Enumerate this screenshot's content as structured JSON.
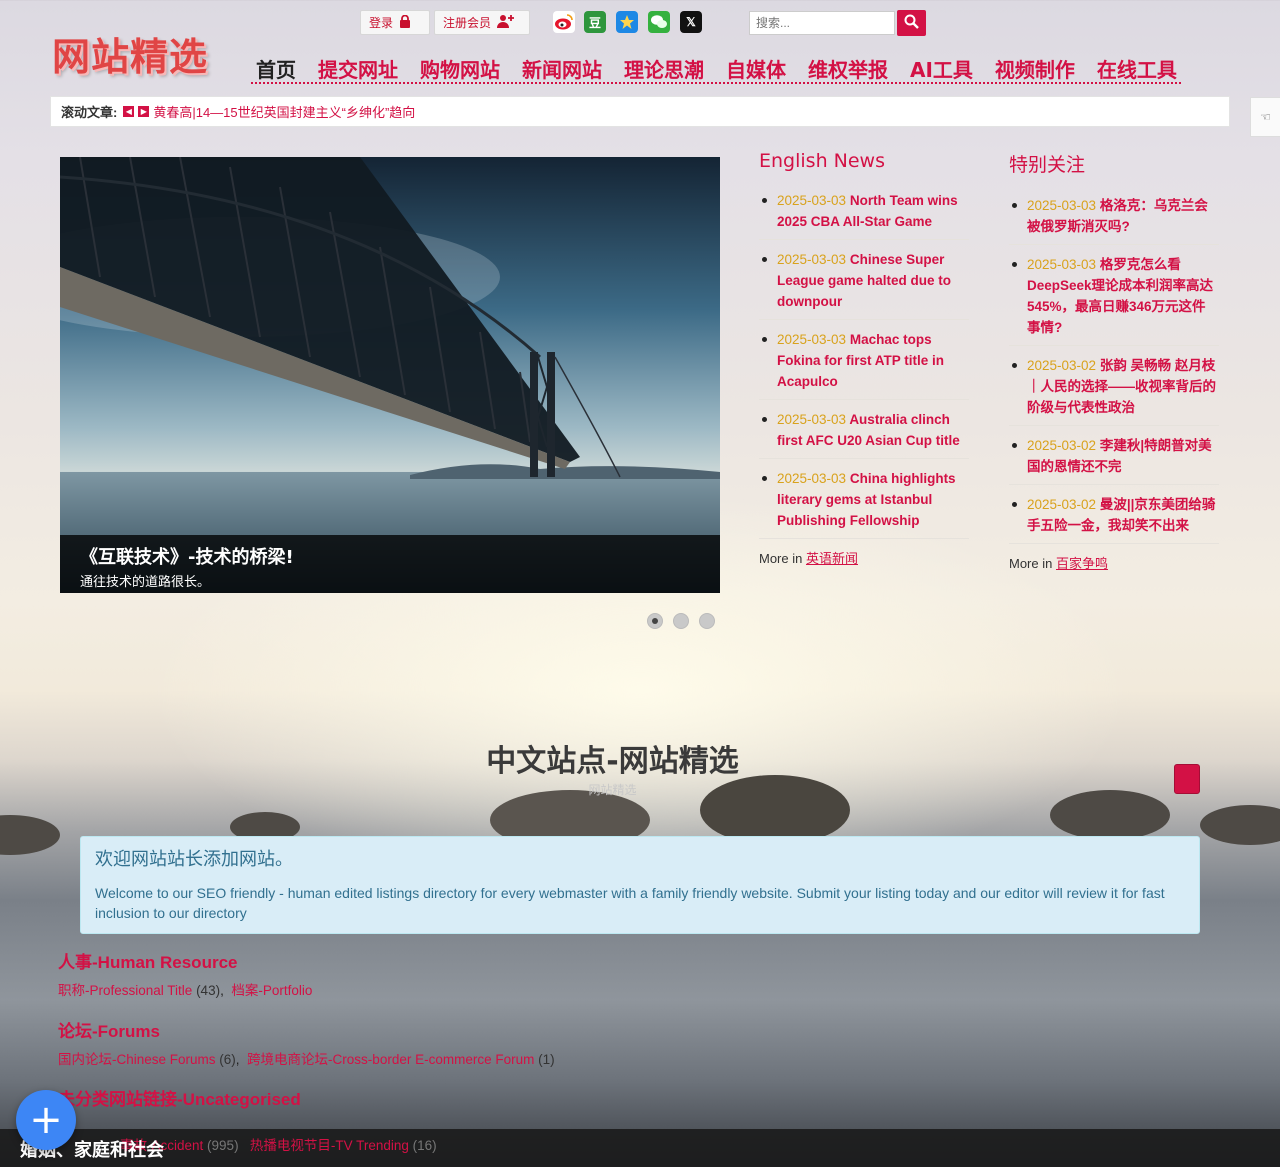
{
  "header": {
    "logo_text": "网站精选",
    "login_label": "登录",
    "register_label": "注册会员",
    "social_icons": [
      "weibo-icon",
      "douban-icon",
      "qzone-icon",
      "wechat-icon",
      "x-icon"
    ],
    "douban_glyph": "豆",
    "x_glyph": "𝕏",
    "search_placeholder": "搜索..."
  },
  "nav": {
    "items": [
      "首页",
      "提交网址",
      "购物网站",
      "新闻网站",
      "理论思潮",
      "自媒体",
      "维权举报",
      "AI工具",
      "视频制作",
      "在线工具"
    ]
  },
  "ticker": {
    "label": "滚动文章:",
    "text": "黄春高|14—15世纪英国封建主义“乡绅化”趋向"
  },
  "slider": {
    "title": "《互联技术》-技术的桥梁!",
    "subtitle": "通往技术的道路很长。",
    "slide_count": 3,
    "active_slide": 1
  },
  "english_news": {
    "heading": "English News",
    "items": [
      {
        "date": "2025-03-03",
        "title": "North Team wins 2025 CBA All-Star Game"
      },
      {
        "date": "2025-03-03",
        "title": "Chinese Super League game halted due to downpour"
      },
      {
        "date": "2025-03-03",
        "title": "Machac tops Fokina for first ATP title in Acapulco"
      },
      {
        "date": "2025-03-03",
        "title": "Australia clinch first AFC U20 Asian Cup title"
      },
      {
        "date": "2025-03-03",
        "title": "China highlights literary gems at Istanbul Publishing Fellowship"
      }
    ],
    "more_prefix": "More in",
    "more_link": "英语新闻"
  },
  "special": {
    "heading": "特别关注",
    "items": [
      {
        "date": "2025-03-03",
        "title": "格洛克：乌克兰会被俄罗斯消灭吗?"
      },
      {
        "date": "2025-03-03",
        "title": "格罗克怎么看DeepSeek理论成本利润率高达545%，最高日赚346万元这件事情?"
      },
      {
        "date": "2025-03-02",
        "title": "张韵 吴畅畅 赵月枝｜人民的选择——收视率背后的阶级与代表性政治"
      },
      {
        "date": "2025-03-02",
        "title": "李建秋|特朗普对美国的恩情还不完"
      },
      {
        "date": "2025-03-02",
        "title": "曼波||京东美团给骑手五险一金，我却笑不出来"
      }
    ],
    "more_prefix": "More in",
    "more_link": "百家争鸣"
  },
  "section": {
    "title": "中文站点-网站精选",
    "subtitle": "网站精选"
  },
  "welcome": {
    "heading": "欢迎网站站长添加网站。",
    "text": "Welcome to our SEO friendly - human edited listings directory for every webmaster with a family friendly website. Submit your listing today and our editor will review it for fast inclusion to our directory"
  },
  "categories": [
    {
      "title": "人事-Human Resource",
      "links": [
        {
          "name": "职称-Professional Title",
          "count": "(43)"
        },
        {
          "name": "档案-Portfolio",
          "count": ""
        }
      ]
    },
    {
      "title": "论坛-Forums",
      "links": [
        {
          "name": "国内论坛-Chinese Forums",
          "count": "(6)"
        },
        {
          "name": "跨境电商论坛-Cross-border E-commerce Forum",
          "count": "(1)"
        }
      ]
    },
    {
      "title": "未分类网站链接-Uncategorised",
      "links": []
    }
  ],
  "bottom": {
    "title": "婚姻、家庭和社会",
    "links": [
      {
        "name": "事故-Accident",
        "count": "(995)"
      },
      {
        "name": "热播电视节目-TV Trending",
        "count": "(16)"
      }
    ]
  },
  "colors": {
    "accent": "#d31145",
    "date": "#d9a21c",
    "fab": "#3d86f5"
  }
}
